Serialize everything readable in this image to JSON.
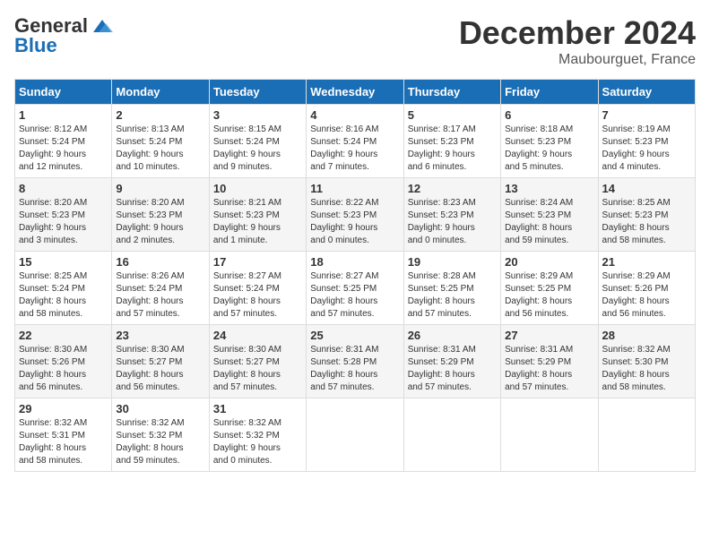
{
  "header": {
    "logo_general": "General",
    "logo_blue": "Blue",
    "month": "December 2024",
    "location": "Maubourguet, France"
  },
  "weekdays": [
    "Sunday",
    "Monday",
    "Tuesday",
    "Wednesday",
    "Thursday",
    "Friday",
    "Saturday"
  ],
  "weeks": [
    [
      {
        "day": "1",
        "detail": "Sunrise: 8:12 AM\nSunset: 5:24 PM\nDaylight: 9 hours\nand 12 minutes."
      },
      {
        "day": "2",
        "detail": "Sunrise: 8:13 AM\nSunset: 5:24 PM\nDaylight: 9 hours\nand 10 minutes."
      },
      {
        "day": "3",
        "detail": "Sunrise: 8:15 AM\nSunset: 5:24 PM\nDaylight: 9 hours\nand 9 minutes."
      },
      {
        "day": "4",
        "detail": "Sunrise: 8:16 AM\nSunset: 5:24 PM\nDaylight: 9 hours\nand 7 minutes."
      },
      {
        "day": "5",
        "detail": "Sunrise: 8:17 AM\nSunset: 5:23 PM\nDaylight: 9 hours\nand 6 minutes."
      },
      {
        "day": "6",
        "detail": "Sunrise: 8:18 AM\nSunset: 5:23 PM\nDaylight: 9 hours\nand 5 minutes."
      },
      {
        "day": "7",
        "detail": "Sunrise: 8:19 AM\nSunset: 5:23 PM\nDaylight: 9 hours\nand 4 minutes."
      }
    ],
    [
      {
        "day": "8",
        "detail": "Sunrise: 8:20 AM\nSunset: 5:23 PM\nDaylight: 9 hours\nand 3 minutes."
      },
      {
        "day": "9",
        "detail": "Sunrise: 8:20 AM\nSunset: 5:23 PM\nDaylight: 9 hours\nand 2 minutes."
      },
      {
        "day": "10",
        "detail": "Sunrise: 8:21 AM\nSunset: 5:23 PM\nDaylight: 9 hours\nand 1 minute."
      },
      {
        "day": "11",
        "detail": "Sunrise: 8:22 AM\nSunset: 5:23 PM\nDaylight: 9 hours\nand 0 minutes."
      },
      {
        "day": "12",
        "detail": "Sunrise: 8:23 AM\nSunset: 5:23 PM\nDaylight: 9 hours\nand 0 minutes."
      },
      {
        "day": "13",
        "detail": "Sunrise: 8:24 AM\nSunset: 5:23 PM\nDaylight: 8 hours\nand 59 minutes."
      },
      {
        "day": "14",
        "detail": "Sunrise: 8:25 AM\nSunset: 5:23 PM\nDaylight: 8 hours\nand 58 minutes."
      }
    ],
    [
      {
        "day": "15",
        "detail": "Sunrise: 8:25 AM\nSunset: 5:24 PM\nDaylight: 8 hours\nand 58 minutes."
      },
      {
        "day": "16",
        "detail": "Sunrise: 8:26 AM\nSunset: 5:24 PM\nDaylight: 8 hours\nand 57 minutes."
      },
      {
        "day": "17",
        "detail": "Sunrise: 8:27 AM\nSunset: 5:24 PM\nDaylight: 8 hours\nand 57 minutes."
      },
      {
        "day": "18",
        "detail": "Sunrise: 8:27 AM\nSunset: 5:25 PM\nDaylight: 8 hours\nand 57 minutes."
      },
      {
        "day": "19",
        "detail": "Sunrise: 8:28 AM\nSunset: 5:25 PM\nDaylight: 8 hours\nand 57 minutes."
      },
      {
        "day": "20",
        "detail": "Sunrise: 8:29 AM\nSunset: 5:25 PM\nDaylight: 8 hours\nand 56 minutes."
      },
      {
        "day": "21",
        "detail": "Sunrise: 8:29 AM\nSunset: 5:26 PM\nDaylight: 8 hours\nand 56 minutes."
      }
    ],
    [
      {
        "day": "22",
        "detail": "Sunrise: 8:30 AM\nSunset: 5:26 PM\nDaylight: 8 hours\nand 56 minutes."
      },
      {
        "day": "23",
        "detail": "Sunrise: 8:30 AM\nSunset: 5:27 PM\nDaylight: 8 hours\nand 56 minutes."
      },
      {
        "day": "24",
        "detail": "Sunrise: 8:30 AM\nSunset: 5:27 PM\nDaylight: 8 hours\nand 57 minutes."
      },
      {
        "day": "25",
        "detail": "Sunrise: 8:31 AM\nSunset: 5:28 PM\nDaylight: 8 hours\nand 57 minutes."
      },
      {
        "day": "26",
        "detail": "Sunrise: 8:31 AM\nSunset: 5:29 PM\nDaylight: 8 hours\nand 57 minutes."
      },
      {
        "day": "27",
        "detail": "Sunrise: 8:31 AM\nSunset: 5:29 PM\nDaylight: 8 hours\nand 57 minutes."
      },
      {
        "day": "28",
        "detail": "Sunrise: 8:32 AM\nSunset: 5:30 PM\nDaylight: 8 hours\nand 58 minutes."
      }
    ],
    [
      {
        "day": "29",
        "detail": "Sunrise: 8:32 AM\nSunset: 5:31 PM\nDaylight: 8 hours\nand 58 minutes."
      },
      {
        "day": "30",
        "detail": "Sunrise: 8:32 AM\nSunset: 5:32 PM\nDaylight: 8 hours\nand 59 minutes."
      },
      {
        "day": "31",
        "detail": "Sunrise: 8:32 AM\nSunset: 5:32 PM\nDaylight: 9 hours\nand 0 minutes."
      },
      null,
      null,
      null,
      null
    ]
  ]
}
